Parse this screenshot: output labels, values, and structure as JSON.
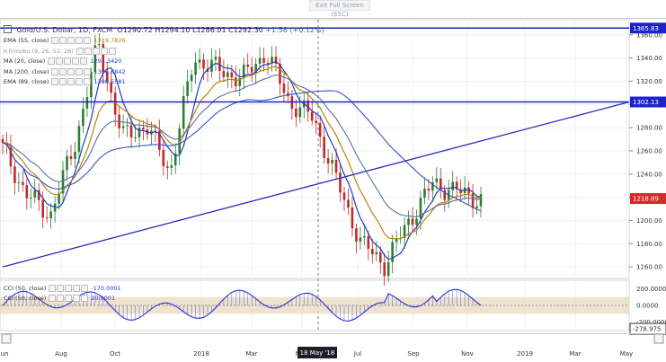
{
  "toolbar": {
    "fullscreen_label": "Exit Full Screen (ESC)"
  },
  "symbol": {
    "name": "Gold/U.S. Dollar, 1D, FXCM",
    "open": "O1290.72",
    "high": "H1294.10",
    "low": "L1286.01",
    "close": "C1292.30",
    "change": "+1.58 (+0.12%)"
  },
  "indicators": [
    {
      "label": "EMA (55, close)",
      "value": "1319.7826",
      "color": "#b8860b"
    },
    {
      "label": "Ichimoku (9, 26, 52, 26)",
      "value": "",
      "color": "#999999"
    },
    {
      "label": "MA (20, close)",
      "value": "1291.3420",
      "color": "#1f3fbf"
    },
    {
      "label": "MA (200, close)",
      "value": "1306.6842",
      "color": "#1f3fbf"
    },
    {
      "label": "EMA (89, close)",
      "value": "1308.5581",
      "color": "#1f3fbf"
    }
  ],
  "colors": {
    "up": "#2e7d32",
    "down": "#c62828",
    "hline": "#1d24c8",
    "trend": "#2a2fb8",
    "ema55": "#b8860b",
    "ma20": "#1f3fbf",
    "ma200": "#3557c2",
    "ema89": "#5b6fa0",
    "cci": "#2b34d6",
    "cci_band": "#ead9bd",
    "last_price": "#d42a2a"
  },
  "chart_data": {
    "type": "candlestick",
    "price_axis": {
      "ticks": [
        1160,
        1180,
        1200,
        1220,
        1240,
        1260,
        1280,
        1300,
        1320,
        1340,
        1360
      ],
      "range": [
        1150,
        1373
      ]
    },
    "time_axis": {
      "labels": [
        "Jun",
        "Aug",
        "Oct",
        "2018",
        "Mar",
        "May",
        "Jul",
        "Sep",
        "Nov",
        "2019",
        "Mar",
        "May"
      ]
    },
    "crosshair_label": "18 May '18",
    "horizontal_lines": [
      {
        "price": 1365.83,
        "label": "1365.83"
      },
      {
        "price": 1302.13,
        "label": "1302.13"
      }
    ],
    "last_price_label": "1218.89",
    "trendline": {
      "from": [
        "Jun 2017",
        1160
      ],
      "to": [
        "May 2019",
        1302
      ]
    },
    "price_series_anchors": [
      [
        "Jun",
        1262
      ],
      [
        "Jul",
        1222
      ],
      [
        "Jul-b",
        1205
      ],
      [
        "Aug",
        1265
      ],
      [
        "Sep",
        1352
      ],
      [
        "Oct",
        1272
      ],
      [
        "Nov",
        1282
      ],
      [
        "Dec",
        1242
      ],
      [
        "Jan",
        1340
      ],
      [
        "Feb",
        1330
      ],
      [
        "Mar",
        1322
      ],
      [
        "Apr",
        1345
      ],
      [
        "May",
        1302
      ],
      [
        "Jun",
        1288
      ],
      [
        "Jul",
        1232
      ],
      [
        "Aug",
        1180
      ],
      [
        "Aug-b",
        1162
      ],
      [
        "Sep",
        1200
      ],
      [
        "Oct",
        1232
      ],
      [
        "Nov",
        1225
      ],
      [
        "Dec-start",
        1218
      ]
    ],
    "cci_panel": {
      "title": "CCI (50, close)",
      "value": "-170.0001",
      "title2": "CCI (50, close)",
      "value2": "20.0001",
      "ticks": [
        "200.0000",
        "0.0000",
        "-200.0000"
      ],
      "last_label": "-278.975",
      "range": [
        -300,
        300
      ]
    }
  }
}
